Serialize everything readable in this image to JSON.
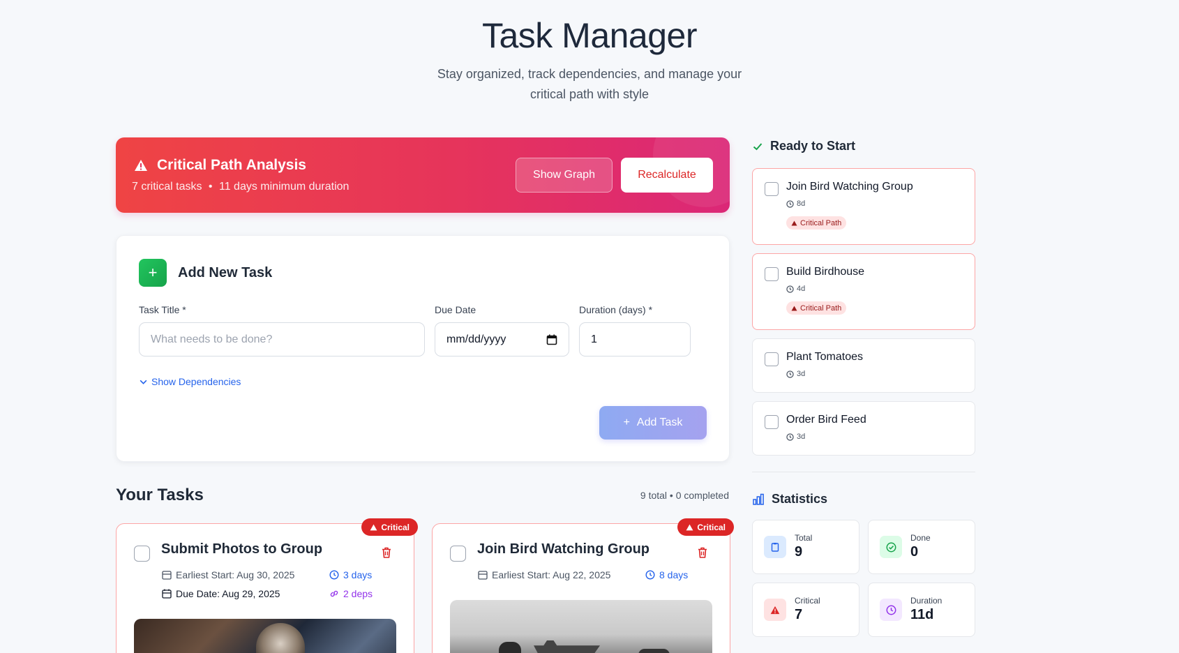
{
  "header": {
    "title": "Task Manager",
    "subtitle": "Stay organized, track dependencies, and manage your critical path with style"
  },
  "banner": {
    "title": "Critical Path Analysis",
    "critical_tasks": "7 critical tasks",
    "separator": "•",
    "min_duration": "11 days minimum duration",
    "show_graph_label": "Show Graph",
    "recalculate_label": "Recalculate"
  },
  "add_task": {
    "plus": "+",
    "title": "Add New Task",
    "task_title_label": "Task Title *",
    "task_title_placeholder": "What needs to be done?",
    "due_date_label": "Due Date",
    "due_date_value": "mm/dd/yyyy",
    "duration_label": "Duration (days) *",
    "duration_value": "1",
    "show_dependencies": "Show Dependencies",
    "add_button_plus": "+",
    "add_button_label": "Add Task"
  },
  "tasks": {
    "heading": "Your Tasks",
    "count": "9 total • 0 completed",
    "items": [
      {
        "badge": "Critical",
        "title": "Submit Photos to Group",
        "earliest_start": "Earliest Start: Aug 30, 2025",
        "duration": "3 days",
        "due_date": "Due Date: Aug 29, 2025",
        "deps": "2 deps"
      },
      {
        "badge": "Critical",
        "title": "Join Bird Watching Group",
        "earliest_start": "Earliest Start: Aug 22, 2025",
        "duration": "8 days"
      }
    ]
  },
  "ready": {
    "heading": "Ready to Start",
    "critical_badge": "Critical Path",
    "items": [
      {
        "title": "Join Bird Watching Group",
        "duration": "8d",
        "critical": true
      },
      {
        "title": "Build Birdhouse",
        "duration": "4d",
        "critical": true
      },
      {
        "title": "Plant Tomatoes",
        "duration": "3d",
        "critical": false
      },
      {
        "title": "Order Bird Feed",
        "duration": "3d",
        "critical": false
      }
    ]
  },
  "statistics": {
    "heading": "Statistics",
    "total_label": "Total",
    "total_value": "9",
    "done_label": "Done",
    "done_value": "0",
    "critical_label": "Critical",
    "critical_value": "7",
    "duration_label": "Duration",
    "duration_value": "11d"
  },
  "colors": {
    "accent_red": "#dc2626",
    "accent_blue": "#2563eb",
    "accent_green": "#16a34a",
    "accent_purple": "#9333ea",
    "background": "#f6f8fb"
  },
  "icons": {
    "banner": "warning-triangle-icon",
    "ready": "check-icon",
    "statistics": "bar-chart-icon",
    "delete": "trash-icon",
    "calendar": "calendar-icon",
    "clock": "clock-icon",
    "link": "link-icon"
  }
}
